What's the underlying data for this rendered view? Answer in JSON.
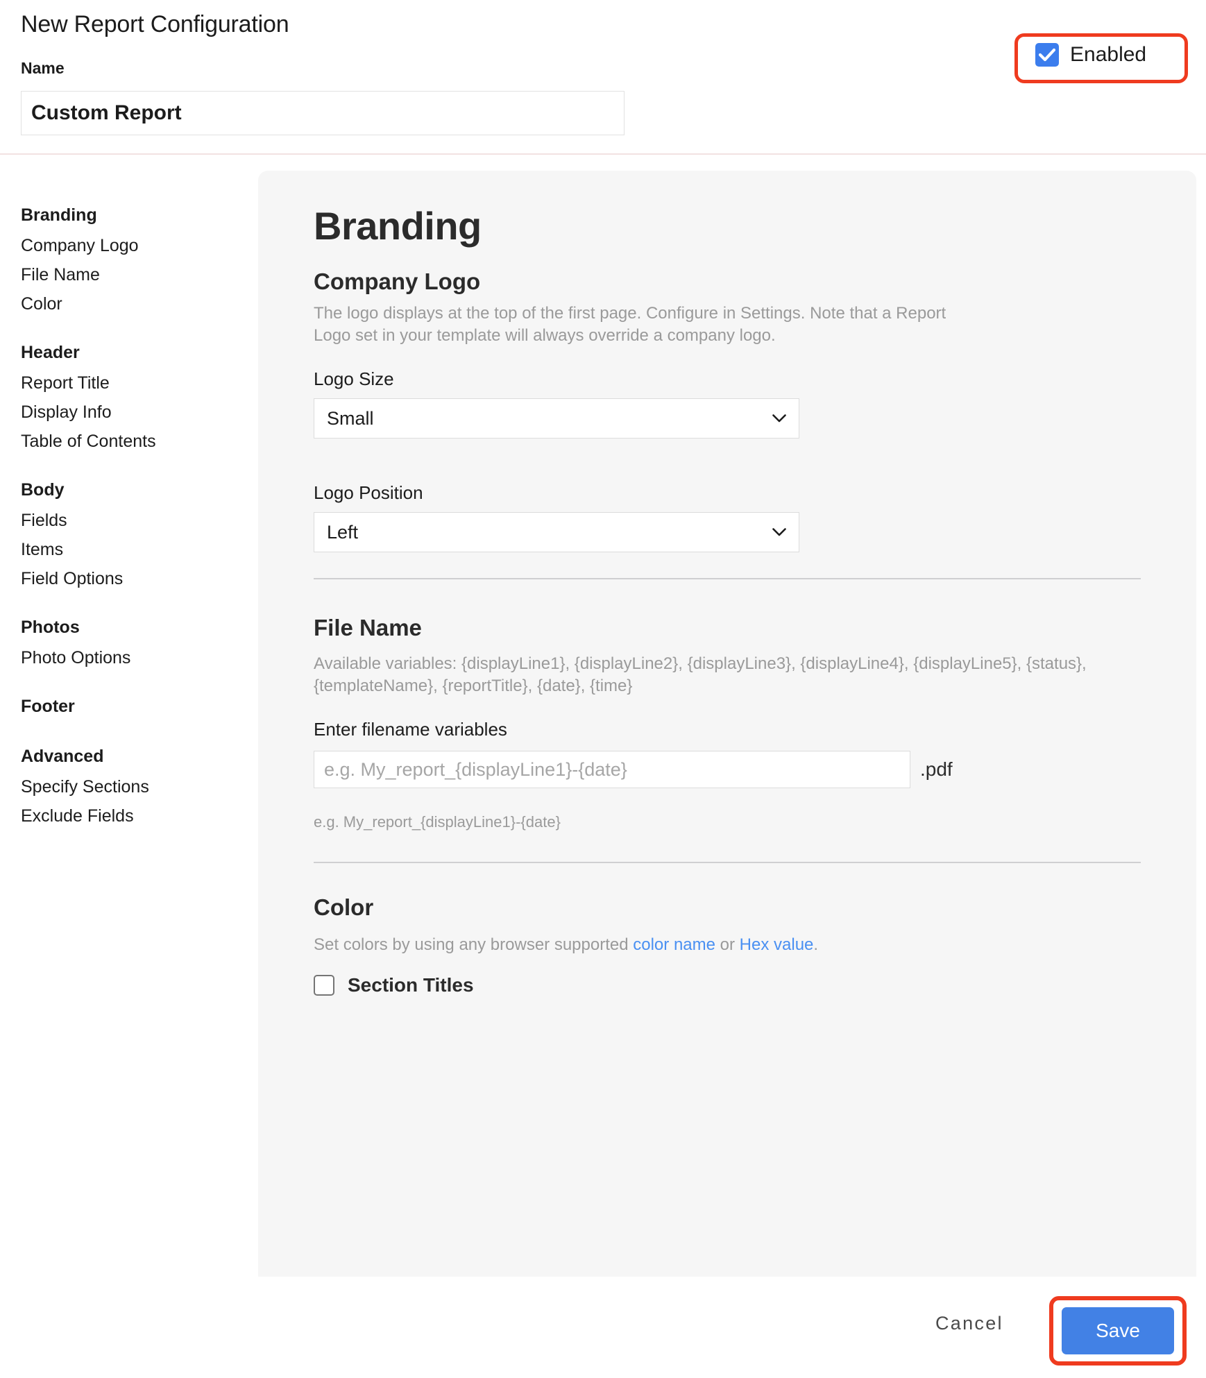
{
  "header": {
    "title": "New Report Configuration",
    "name_label": "Name",
    "name_value": "Custom Report",
    "enabled_label": "Enabled",
    "enabled_checked": true,
    "highlight_color": "#ef3b1f",
    "checkbox_color": "#3b7ded"
  },
  "sidebar": {
    "groups": [
      {
        "heading": "Branding",
        "items": [
          "Company Logo",
          "File Name",
          "Color"
        ]
      },
      {
        "heading": "Header",
        "items": [
          "Report Title",
          "Display Info",
          "Table of Contents"
        ]
      },
      {
        "heading": "Body",
        "items": [
          "Fields",
          "Items",
          "Field Options"
        ]
      },
      {
        "heading": "Photos",
        "items": [
          "Photo Options"
        ]
      },
      {
        "heading": "Footer",
        "items": []
      },
      {
        "heading": "Advanced",
        "items": [
          "Specify Sections",
          "Exclude Fields"
        ]
      }
    ]
  },
  "main": {
    "page_heading": "Branding",
    "company_logo": {
      "heading": "Company Logo",
      "description": "The logo displays at the top of the first page. Configure in Settings. Note that a Report Logo set in your template will always override a company logo.",
      "logo_size_label": "Logo Size",
      "logo_size_value": "Small",
      "logo_position_label": "Logo Position",
      "logo_position_value": "Left"
    },
    "file_name": {
      "heading": "File Name",
      "available_variables": "Available variables: {displayLine1}, {displayLine2}, {displayLine3}, {displayLine4}, {displayLine5}, {status}, {templateName}, {reportTitle}, {date}, {time}",
      "input_label": "Enter filename variables",
      "input_value": "",
      "input_placeholder": "e.g. My_report_{displayLine1}-{date}",
      "suffix": ".pdf",
      "hint": "e.g. My_report_{displayLine1}-{date}"
    },
    "color": {
      "heading": "Color",
      "description_before": "Set colors by using any browser supported ",
      "link_color_name": "color name",
      "description_middle": " or ",
      "link_hex_value": "Hex value",
      "description_after": ".",
      "section_titles_label": "Section Titles",
      "section_titles_checked": false,
      "link_color": "#4a90f2"
    }
  },
  "footer": {
    "cancel_label": "Cancel",
    "save_label": "Save",
    "save_color": "#4281e5",
    "highlight_color": "#ef3b1f"
  }
}
